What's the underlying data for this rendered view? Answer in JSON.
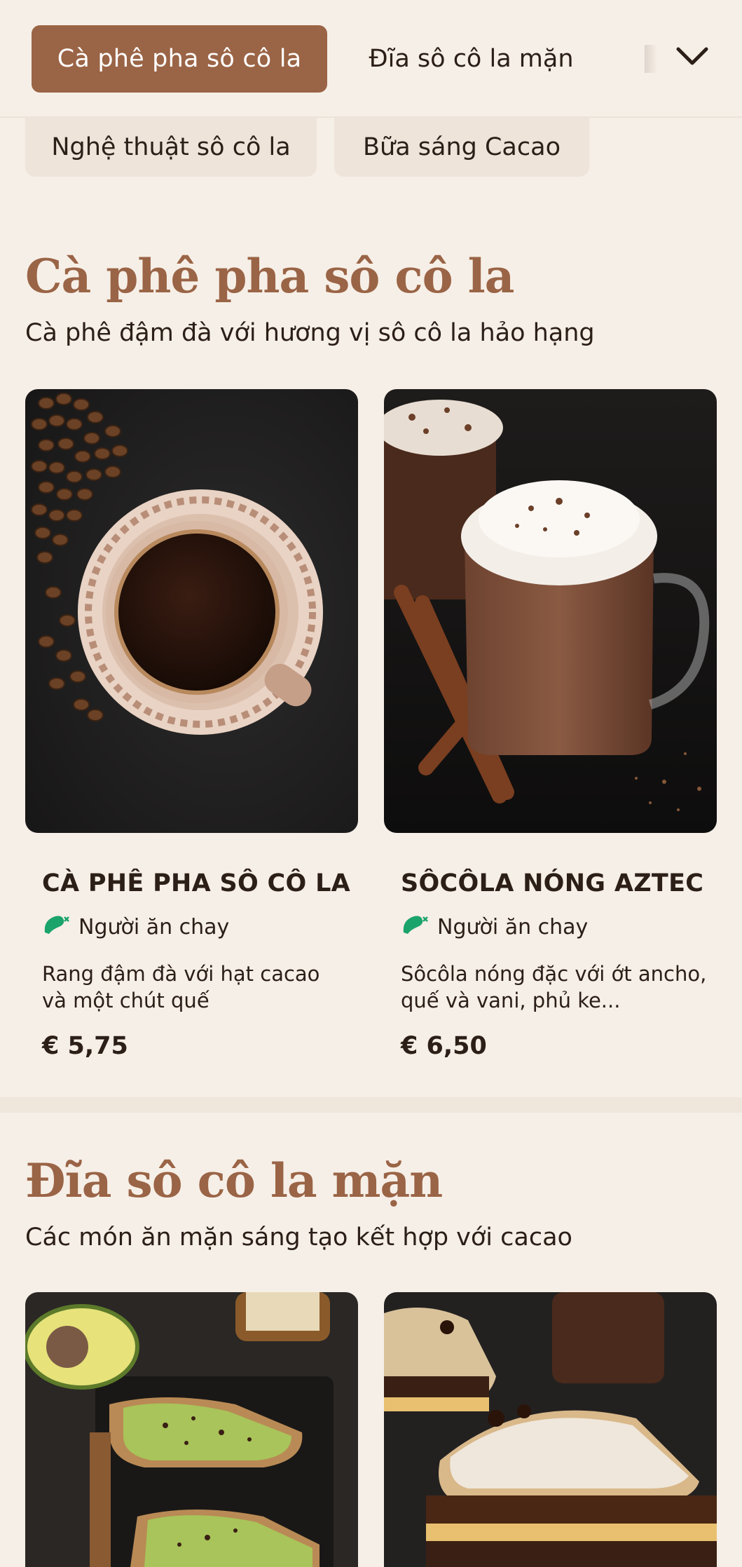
{
  "nav": {
    "tabs": [
      {
        "label": "Cà phê pha sô cô la",
        "active": true
      },
      {
        "label": "Đĩa sô cô la mặn",
        "active": false
      }
    ],
    "chips": [
      {
        "label": "Nghệ thuật sô cô la"
      },
      {
        "label": "Bữa sáng Cacao"
      }
    ],
    "expand_icon": "chevron-down-icon"
  },
  "sections": [
    {
      "title": "Cà phê pha sô cô la",
      "subtitle": "Cà phê đậm đà với hương vị sô cô la hảo hạng",
      "items": [
        {
          "name": "CÀ PHÊ PHA SÔ CÔ LA",
          "diet": "Người ăn chay",
          "description": "Rang đậm đà với hạt cacao và một chút quế",
          "price": "€ 5,75",
          "image": "black coffee cup on saucer with coffee beans"
        },
        {
          "name": "SÔCÔLA NÓNG AZTEC",
          "diet": "Người ăn chay",
          "description": "Sôcôla nóng đặc với ớt ancho, quế và vani, phủ ke...",
          "price": "€ 6,50",
          "image": "hot chocolate with whipped cream and cinnamon sticks"
        }
      ]
    },
    {
      "title": "Đĩa sô cô la mặn",
      "subtitle": "Các món ăn mặn sáng tạo kết hợp với cacao",
      "items": [
        {
          "image": "avocado toast with cacao nibs"
        },
        {
          "image": "grilled chocolate sandwich with powdered sugar"
        }
      ]
    }
  ],
  "colors": {
    "accent": "#9a6446",
    "background": "#f6efe7",
    "chip": "#eee4da",
    "veg_icon": "#1aa36b"
  }
}
